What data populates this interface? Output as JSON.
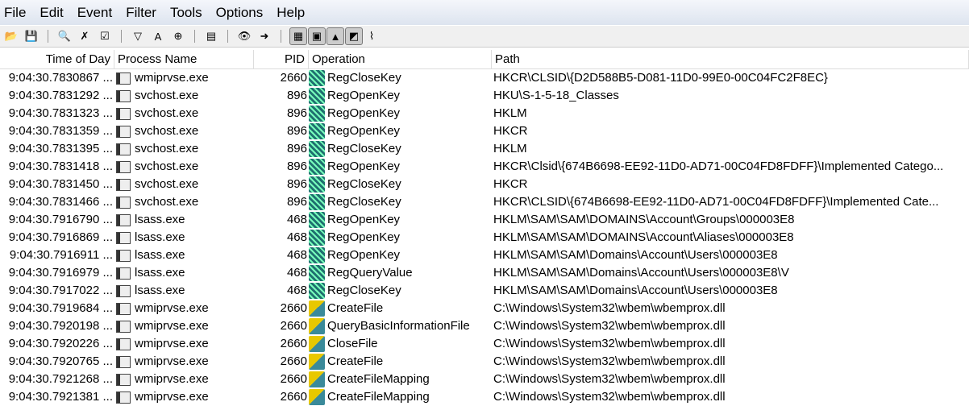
{
  "menu": [
    "File",
    "Edit",
    "Event",
    "Filter",
    "Tools",
    "Options",
    "Help"
  ],
  "toolbar": [
    {
      "name": "open-icon",
      "glyph": "📂"
    },
    {
      "name": "save-icon",
      "glyph": "💾"
    },
    {
      "sep": true
    },
    {
      "name": "autoscroll-icon",
      "glyph": "🔍"
    },
    {
      "name": "clear-icon",
      "glyph": "✗"
    },
    {
      "name": "capture-icon",
      "glyph": "☑"
    },
    {
      "sep": true
    },
    {
      "name": "filter-icon",
      "glyph": "▽"
    },
    {
      "name": "highlight-icon",
      "glyph": "A"
    },
    {
      "name": "target-icon",
      "glyph": "⊕"
    },
    {
      "sep": true
    },
    {
      "name": "process-tree-icon",
      "glyph": "▤"
    },
    {
      "sep": true
    },
    {
      "name": "find-icon",
      "glyph": "👁"
    },
    {
      "name": "jump-icon",
      "glyph": "➜"
    },
    {
      "sep": true
    },
    {
      "name": "registry-activity-icon",
      "glyph": "▦",
      "toggle": true
    },
    {
      "name": "file-activity-icon",
      "glyph": "▣",
      "toggle": true
    },
    {
      "name": "network-activity-icon",
      "glyph": "▲",
      "toggle": true
    },
    {
      "name": "process-activity-icon",
      "glyph": "◩",
      "toggle": true
    },
    {
      "name": "profiling-icon",
      "glyph": "⌇"
    }
  ],
  "columns": [
    "Time of Day",
    "Process Name",
    "PID",
    "Operation",
    "Path"
  ],
  "rows": [
    [
      "9:04:30.7830867 ...",
      "wmiprvse.exe",
      "2660",
      "RegCloseKey",
      "HKCR\\CLSID\\{D2D588B5-D081-11D0-99E0-00C04FC2F8EC}",
      "reg"
    ],
    [
      "9:04:30.7831292 ...",
      "svchost.exe",
      "896",
      "RegOpenKey",
      "HKU\\S-1-5-18_Classes",
      "reg"
    ],
    [
      "9:04:30.7831323 ...",
      "svchost.exe",
      "896",
      "RegOpenKey",
      "HKLM",
      "reg"
    ],
    [
      "9:04:30.7831359 ...",
      "svchost.exe",
      "896",
      "RegOpenKey",
      "HKCR",
      "reg"
    ],
    [
      "9:04:30.7831395 ...",
      "svchost.exe",
      "896",
      "RegCloseKey",
      "HKLM",
      "reg"
    ],
    [
      "9:04:30.7831418 ...",
      "svchost.exe",
      "896",
      "RegOpenKey",
      "HKCR\\Clsid\\{674B6698-EE92-11D0-AD71-00C04FD8FDFF}\\Implemented Catego...",
      "reg"
    ],
    [
      "9:04:30.7831450 ...",
      "svchost.exe",
      "896",
      "RegCloseKey",
      "HKCR",
      "reg"
    ],
    [
      "9:04:30.7831466 ...",
      "svchost.exe",
      "896",
      "RegCloseKey",
      "HKCR\\CLSID\\{674B6698-EE92-11D0-AD71-00C04FD8FDFF}\\Implemented Cate...",
      "reg"
    ],
    [
      "9:04:30.7916790 ...",
      "lsass.exe",
      "468",
      "RegOpenKey",
      "HKLM\\SAM\\SAM\\DOMAINS\\Account\\Groups\\000003E8",
      "reg"
    ],
    [
      "9:04:30.7916869 ...",
      "lsass.exe",
      "468",
      "RegOpenKey",
      "HKLM\\SAM\\SAM\\DOMAINS\\Account\\Aliases\\000003E8",
      "reg"
    ],
    [
      "9:04:30.7916911 ...",
      "lsass.exe",
      "468",
      "RegOpenKey",
      "HKLM\\SAM\\SAM\\Domains\\Account\\Users\\000003E8",
      "reg"
    ],
    [
      "9:04:30.7916979 ...",
      "lsass.exe",
      "468",
      "RegQueryValue",
      "HKLM\\SAM\\SAM\\Domains\\Account\\Users\\000003E8\\V",
      "reg"
    ],
    [
      "9:04:30.7917022 ...",
      "lsass.exe",
      "468",
      "RegCloseKey",
      "HKLM\\SAM\\SAM\\Domains\\Account\\Users\\000003E8",
      "reg"
    ],
    [
      "9:04:30.7919684 ...",
      "wmiprvse.exe",
      "2660",
      "CreateFile",
      "C:\\Windows\\System32\\wbem\\wbemprox.dll",
      "file"
    ],
    [
      "9:04:30.7920198 ...",
      "wmiprvse.exe",
      "2660",
      "QueryBasicInformationFile",
      "C:\\Windows\\System32\\wbem\\wbemprox.dll",
      "file"
    ],
    [
      "9:04:30.7920226 ...",
      "wmiprvse.exe",
      "2660",
      "CloseFile",
      "C:\\Windows\\System32\\wbem\\wbemprox.dll",
      "file"
    ],
    [
      "9:04:30.7920765 ...",
      "wmiprvse.exe",
      "2660",
      "CreateFile",
      "C:\\Windows\\System32\\wbem\\wbemprox.dll",
      "file"
    ],
    [
      "9:04:30.7921268 ...",
      "wmiprvse.exe",
      "2660",
      "CreateFileMapping",
      "C:\\Windows\\System32\\wbem\\wbemprox.dll",
      "file"
    ],
    [
      "9:04:30.7921381 ...",
      "wmiprvse.exe",
      "2660",
      "CreateFileMapping",
      "C:\\Windows\\System32\\wbem\\wbemprox.dll",
      "file"
    ]
  ]
}
